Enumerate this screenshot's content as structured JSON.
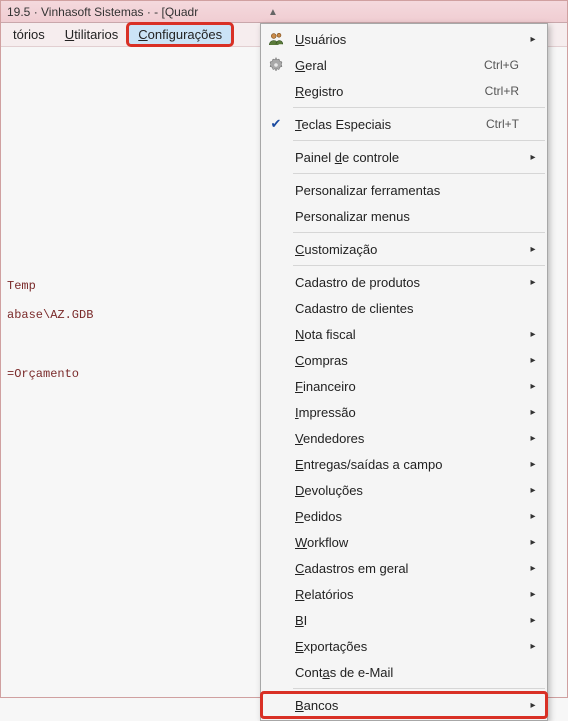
{
  "window": {
    "title": "19.5 · Vinhasoft Sistemas ·  -  [Quadr"
  },
  "menubar": {
    "items": [
      {
        "label": "tórios",
        "underlined": ""
      },
      {
        "label": "Utilitarios",
        "underlined": "U"
      },
      {
        "label": "Configurações",
        "underlined": "C"
      }
    ]
  },
  "content": {
    "line1": "Temp",
    "line2": "abase\\AZ.GDB",
    "line3": "=Orçamento"
  },
  "dropdown": {
    "items": [
      {
        "label": "Usuários",
        "ul": "U",
        "arrow": true,
        "icon": "users-icon"
      },
      {
        "label": "Geral",
        "ul": "G",
        "shortcut": "Ctrl+G",
        "icon": "gear-icon"
      },
      {
        "label": "Registro",
        "ul": "R",
        "shortcut": "Ctrl+R"
      },
      {
        "sep": true
      },
      {
        "label": "Teclas Especiais",
        "ul": "T",
        "shortcut": "Ctrl+T",
        "checked": true
      },
      {
        "sep": true
      },
      {
        "label": "Painel de controle",
        "ul_inner": "d",
        "arrow": true
      },
      {
        "sep": true
      },
      {
        "label": "Personalizar ferramentas"
      },
      {
        "label": "Personalizar menus"
      },
      {
        "sep": true
      },
      {
        "label": "Customização",
        "ul": "C",
        "arrow": true
      },
      {
        "sep": true
      },
      {
        "label": "Cadastro de produtos",
        "arrow": true
      },
      {
        "label": "Cadastro de clientes"
      },
      {
        "label": "Nota fiscal",
        "ul": "N",
        "arrow": true
      },
      {
        "label": "Compras",
        "ul": "C",
        "arrow": true
      },
      {
        "label": "Financeiro",
        "ul": "F",
        "arrow": true
      },
      {
        "label": "Impressão",
        "ul": "I",
        "arrow": true
      },
      {
        "label": "Vendedores",
        "ul": "V",
        "arrow": true
      },
      {
        "label": "Entregas/saídas a campo",
        "ul": "E",
        "arrow": true
      },
      {
        "label": "Devoluções",
        "ul": "D",
        "arrow": true
      },
      {
        "label": "Pedidos",
        "ul": "P",
        "arrow": true
      },
      {
        "label": "Workflow",
        "ul": "W",
        "arrow": true
      },
      {
        "label": "Cadastros em geral",
        "ul": "C",
        "arrow": true
      },
      {
        "label": "Relatórios",
        "ul": "R",
        "arrow": true
      },
      {
        "label": "BI",
        "ul": "B",
        "arrow": true
      },
      {
        "label": "Exportações",
        "ul": "E",
        "arrow": true
      },
      {
        "label": "Contas de e-Mail",
        "ul_inner": "a"
      },
      {
        "sep": true
      },
      {
        "label": "Bancos",
        "ul": "B",
        "arrow": true,
        "red": true
      }
    ]
  }
}
